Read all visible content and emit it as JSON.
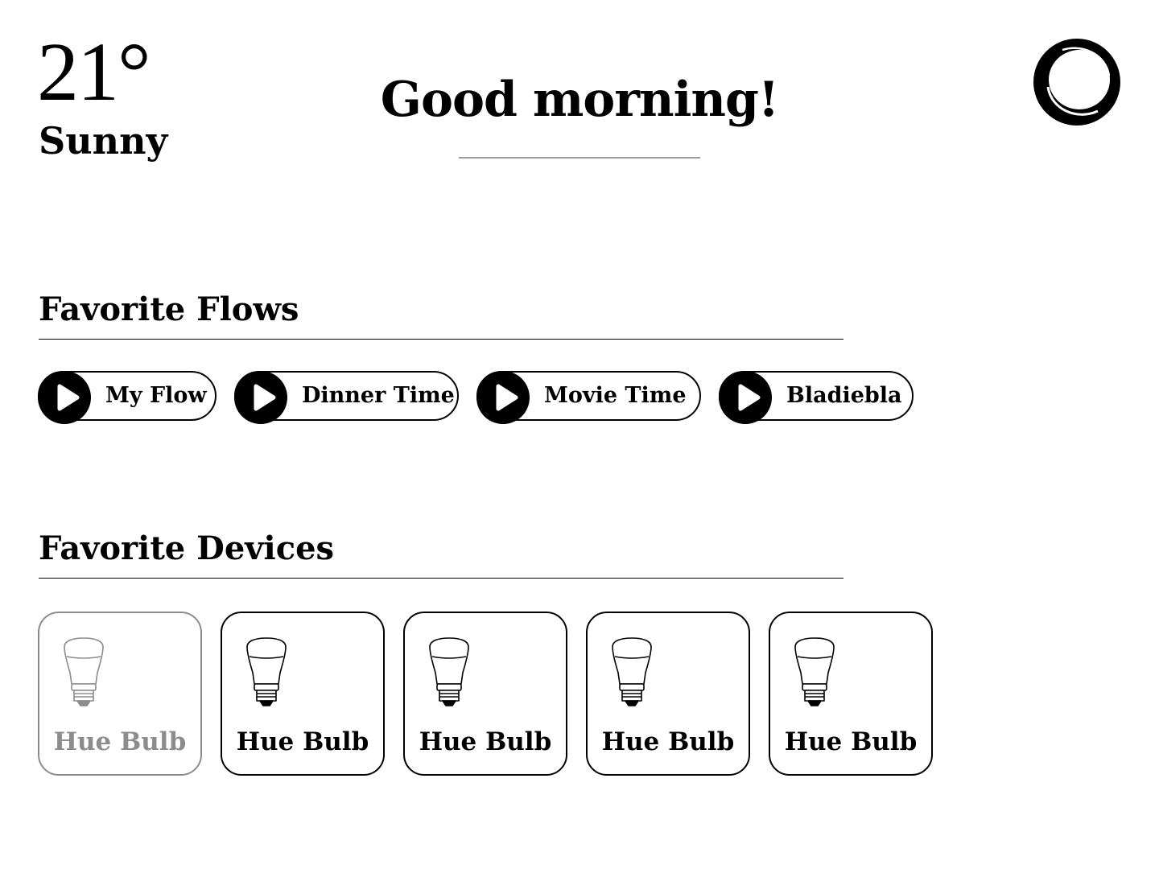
{
  "weather": {
    "temperature": "21°",
    "condition": "Sunny"
  },
  "greeting": "Good morning!",
  "logo_icon": "homey-logo-icon",
  "sections": {
    "flows_title": "Favorite Flows",
    "devices_title": "Favorite Devices"
  },
  "flows": [
    {
      "label": "My Flow",
      "icon": "play-icon"
    },
    {
      "label": "Dinner Time",
      "icon": "play-icon"
    },
    {
      "label": "Movie Time",
      "icon": "play-icon"
    },
    {
      "label": "Bladiebla",
      "icon": "play-icon"
    }
  ],
  "devices": [
    {
      "label": "Hue Bulb",
      "state": "off",
      "icon": "light-bulb-icon"
    },
    {
      "label": "Hue Bulb",
      "state": "on",
      "icon": "light-bulb-icon"
    },
    {
      "label": "Hue Bulb",
      "state": "on",
      "icon": "light-bulb-icon"
    },
    {
      "label": "Hue Bulb",
      "state": "on",
      "icon": "light-bulb-icon"
    },
    {
      "label": "Hue Bulb",
      "state": "on",
      "icon": "light-bulb-icon"
    }
  ],
  "colors": {
    "text": "#000000",
    "inactive": "#8c8c8c",
    "background": "#ffffff"
  }
}
